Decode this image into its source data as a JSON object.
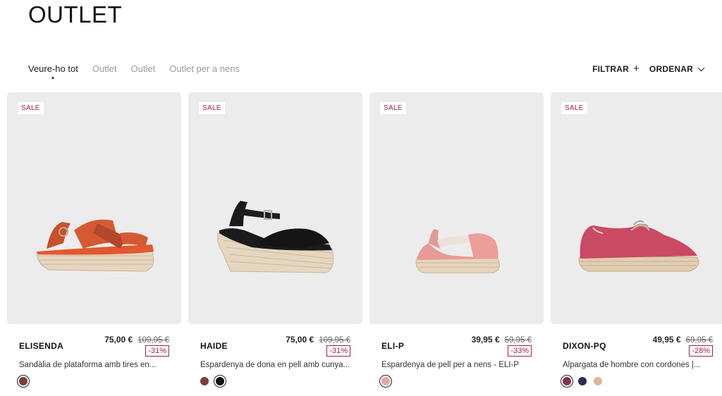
{
  "page": {
    "title": "OUTLET"
  },
  "filters": [
    {
      "label": "Veure-ho tot",
      "active": true
    },
    {
      "label": "Outlet",
      "active": false
    },
    {
      "label": "Outlet",
      "active": false
    },
    {
      "label": "Outlet per a nens",
      "active": false
    }
  ],
  "controls": {
    "filter_label": "FILTRAR",
    "sort_label": "ORDENAR"
  },
  "products": [
    {
      "badge": "SALE",
      "name": "ELISENDA",
      "price": "75,00 €",
      "old_price": "109,95 €",
      "discount": "-31%",
      "description": "Sandàlia de plataforma amb tires en...",
      "swatches": [
        "#7a3f3a"
      ],
      "selected_swatch": 0
    },
    {
      "badge": "SALE",
      "name": "HAIDE",
      "price": "75,00 €",
      "old_price": "109,95 €",
      "discount": "-31%",
      "description": "Espardenya de dona en pell amb cunya...",
      "swatches": [
        "#7a3f3a",
        "#111111"
      ],
      "selected_swatch": 1
    },
    {
      "badge": "SALE",
      "name": "ELI-P",
      "price": "39,95 €",
      "old_price": "59,95 €",
      "discount": "-33%",
      "description": "Espardenya de pell per a nens - ELI-P",
      "swatches": [
        "#e5a9a5"
      ],
      "selected_swatch": 0
    },
    {
      "badge": "SALE",
      "name": "DIXON-PQ",
      "price": "49,95 €",
      "old_price": "69,95 €",
      "discount": "-28%",
      "description": "Alpargata de hombre con cordones |...",
      "swatches": [
        "#8a3346",
        "#2b2f4a",
        "#d9b8a0"
      ],
      "selected_swatch": 0
    }
  ]
}
